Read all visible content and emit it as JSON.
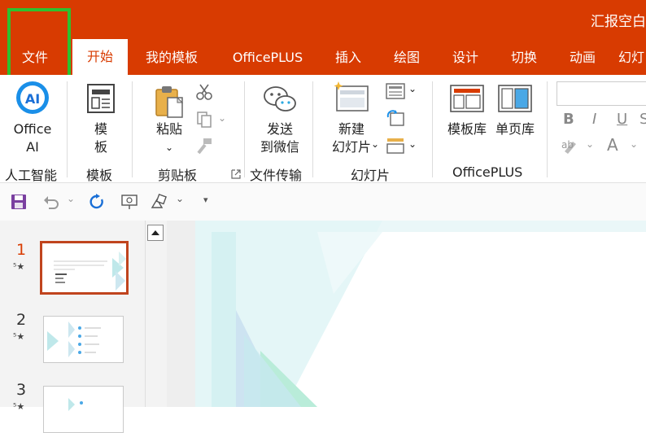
{
  "window": {
    "doc_title": "汇报空白"
  },
  "tabs": [
    {
      "label": "文件"
    },
    {
      "label": "开始"
    },
    {
      "label": "我的模板"
    },
    {
      "label": "OfficePLUS"
    },
    {
      "label": "插入"
    },
    {
      "label": "绘图"
    },
    {
      "label": "设计"
    },
    {
      "label": "切换"
    },
    {
      "label": "动画"
    },
    {
      "label": "幻灯"
    }
  ],
  "ribbon": {
    "ai": {
      "line1": "Office",
      "line2": "AI",
      "group": "人工智能"
    },
    "template": {
      "line1": "模",
      "line2": "板",
      "group": "模板"
    },
    "clipboard": {
      "paste": "粘贴",
      "group": "剪贴板"
    },
    "wechat": {
      "line1": "发送",
      "line2": "到微信",
      "group": "文件传输"
    },
    "slides": {
      "line1": "新建",
      "line2": "幻灯片",
      "group": "幻灯片"
    },
    "officeplus": {
      "lib": "模板库",
      "single": "单页库",
      "group": "OfficePLUS"
    },
    "font": {
      "bold": "B",
      "italic": "I",
      "underline": "U",
      "s": "S",
      "fontA": "A"
    }
  },
  "slides": [
    {
      "number": "1"
    },
    {
      "number": "2"
    },
    {
      "number": "3"
    }
  ],
  "colors": {
    "accent": "#d83b01",
    "highlight": "#2ec02e",
    "thumb_active": "#c0441e"
  }
}
